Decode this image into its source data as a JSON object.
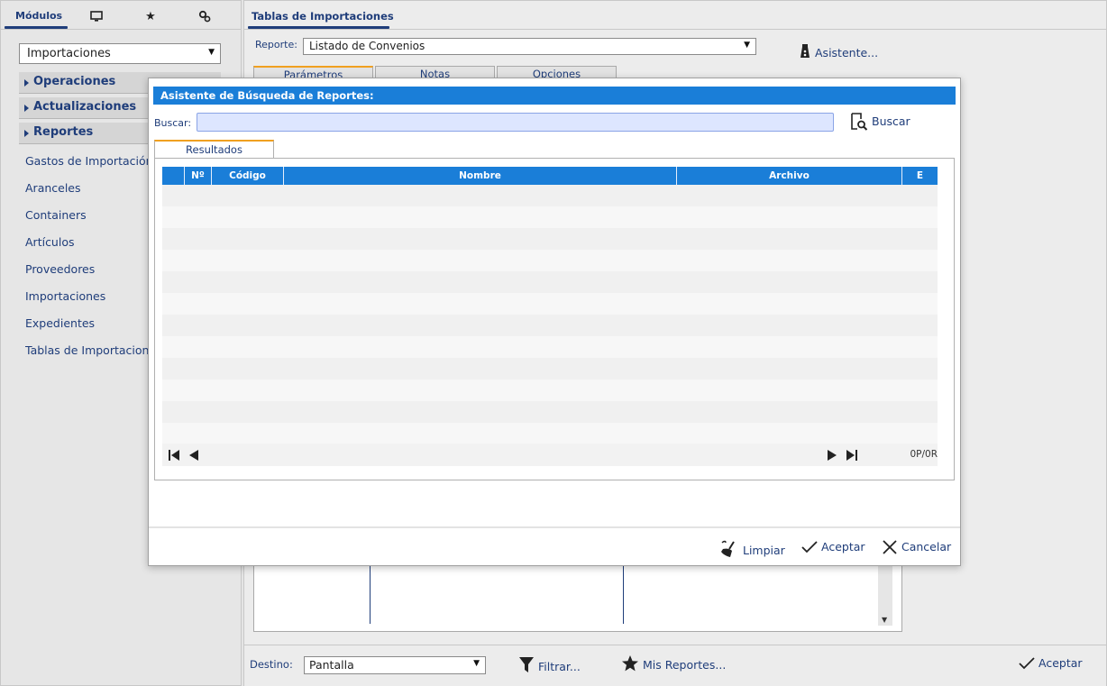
{
  "left_panel": {
    "tabs": {
      "modulos": "Módulos"
    },
    "module_select": "Importaciones",
    "sections": [
      "Operaciones",
      "Actualizaciones",
      "Reportes"
    ],
    "items": [
      "Gastos de Importación",
      "Aranceles",
      "Containers",
      "Artículos",
      "Proveedores",
      "Importaciones",
      "Expedientes",
      "Tablas de Importaciones"
    ]
  },
  "main_panel": {
    "tab_title": "Tablas de Importaciones",
    "reporte_label": "Reporte:",
    "reporte_value": "Listado de Convenios",
    "asistente_label": "Asistente...",
    "tabs": [
      "Parámetros",
      "Notas",
      "Opciones"
    ],
    "destino_label": "Destino:",
    "destino_value": "Pantalla",
    "filtrar_label": "Filtrar...",
    "mis_reportes_label": "Mis Reportes...",
    "aceptar_label": "Aceptar"
  },
  "modal": {
    "title": "Asistente de Búsqueda de Reportes:",
    "buscar_label": "Buscar:",
    "buscar_value": "",
    "buscar_button": "Buscar",
    "results_tab": "Resultados",
    "columns": [
      "Nº",
      "Código",
      "Nombre",
      "Archivo",
      "E"
    ],
    "pager_count": "0P/0R",
    "limpiar_label": "Limpiar",
    "aceptar_label": "Aceptar",
    "cancelar_label": "Cancelar"
  },
  "colors": {
    "accent": "#1a7ed8",
    "text": "#1f3d7a",
    "tab_highlight": "#f0a020"
  }
}
